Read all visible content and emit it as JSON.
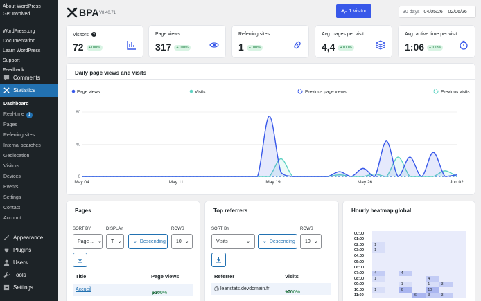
{
  "sidebar": {
    "top_links": [
      "About WordPress",
      "Get Involved",
      "WordPress.org",
      "Documentation",
      "Learn WordPress",
      "Support",
      "Feedback"
    ],
    "comments": "Comments",
    "statistics": "Statistics",
    "subitems": [
      "Dashboard",
      "Real-time",
      "Pages",
      "Referring sites",
      "Internal searches",
      "Geolocation",
      "Visitors",
      "Devices",
      "Events",
      "Settings",
      "Contact",
      "Account"
    ],
    "realtime_badge": "1",
    "bottom": [
      "Appearance",
      "Plugins",
      "Users",
      "Tools",
      "Settings"
    ]
  },
  "header": {
    "logo": "BPA",
    "version": "V8.40.71",
    "visitor_button": "1 Visitor",
    "range_label": "30 days",
    "range_dates": "04/05/26 – 02/06/26"
  },
  "stats": [
    {
      "label": "Visitors",
      "value": "72",
      "change": "+100%",
      "icon": "chart-bars-icon"
    },
    {
      "label": "Page views",
      "value": "317",
      "change": "+100%",
      "icon": "eye-icon"
    },
    {
      "label": "Referring sites",
      "value": "1",
      "change": "+100%",
      "icon": "link-icon"
    },
    {
      "label": "Avg. pages per visit",
      "value": "4,4",
      "change": "+100%",
      "icon": "layers-icon"
    },
    {
      "label": "Avg. active time per visit",
      "value": "1:06",
      "change": "+100%",
      "icon": "timer-icon"
    }
  ],
  "daily": {
    "title": "Daily page views and visits"
  },
  "chart_data": {
    "type": "line",
    "title": "Daily page views and visits",
    "x_ticks": [
      "May 04",
      "May 11",
      "May 19",
      "May 26",
      "Jun 02"
    ],
    "x": [
      "May 04",
      "May 05",
      "May 06",
      "May 07",
      "May 08",
      "May 09",
      "May 10",
      "May 11",
      "May 12",
      "May 13",
      "May 14",
      "May 15",
      "May 16",
      "May 17",
      "May 18",
      "May 19",
      "May 20",
      "May 21",
      "May 22",
      "May 23",
      "May 24",
      "May 25",
      "May 26",
      "May 27",
      "May 28",
      "May 29",
      "May 30",
      "May 31",
      "Jun 01",
      "Jun 02"
    ],
    "ylim": [
      0,
      80
    ],
    "y_ticks": [
      0,
      40,
      80
    ],
    "legend": [
      "Page views",
      "Visits",
      "Previous page views",
      "Previous visits"
    ],
    "series": [
      {
        "name": "Page views",
        "color": "#3858e9",
        "values": [
          0,
          0,
          0,
          0,
          0,
          0,
          0,
          0,
          0,
          0,
          0,
          0,
          0,
          0,
          0,
          0,
          75,
          5,
          0,
          0,
          0,
          0,
          6,
          0,
          10,
          0,
          44,
          0,
          24,
          0,
          30,
          0,
          2
        ]
      },
      {
        "name": "Visits",
        "color": "#5fd3c3",
        "values": [
          0,
          0,
          0,
          0,
          0,
          0,
          0,
          0,
          0,
          0,
          0,
          0,
          0,
          0,
          0,
          0,
          0,
          22,
          0,
          0,
          0,
          0,
          2,
          0,
          0,
          3,
          0,
          24,
          0,
          0,
          0,
          7,
          0
        ]
      },
      {
        "name": "Previous page views",
        "color": "#3858e9",
        "values": [
          0,
          0,
          0,
          0,
          0,
          0,
          0,
          0,
          0,
          0,
          0,
          0,
          0,
          0,
          0,
          0,
          0,
          0,
          0,
          0,
          0,
          0,
          0,
          0,
          0,
          0,
          0,
          0,
          0,
          0,
          0,
          0,
          0
        ]
      },
      {
        "name": "Previous visits",
        "color": "#5fd3c3",
        "values": [
          0,
          0,
          0,
          0,
          0,
          0,
          0,
          0,
          0,
          0,
          0,
          0,
          0,
          0,
          0,
          0,
          0,
          0,
          0,
          0,
          0,
          0,
          0,
          0,
          0,
          0,
          0,
          0,
          0,
          0,
          0,
          0,
          0
        ]
      }
    ]
  },
  "pages": {
    "title": "Pages",
    "sort_by": "SORT BY",
    "display": "DISPLAY",
    "rows": "ROWS",
    "sort_value": "Page ...",
    "display_value": "T.",
    "order_value": "Descending",
    "rows_value": "10",
    "col_title": "Title",
    "col_views": "Page views",
    "row1_title": "Accueil",
    "row1_views": "164",
    "row1_change": "+100%"
  },
  "referrers": {
    "title": "Top referrers",
    "sort_by": "SORT BY",
    "rows": "ROWS",
    "sort_value": "Visits",
    "order_value": "Descending",
    "rows_value": "10",
    "col_ref": "Referrer",
    "col_visits": "Visits",
    "row1_ref": "leanstats.devdomain.fr",
    "row1_visits": "176",
    "row1_change": "+100%"
  },
  "heatmap": {
    "title": "Hourly heatmap global",
    "hours": [
      "00:00",
      "01:00",
      "02:00",
      "03:00",
      "04:00",
      "05:00",
      "06:00",
      "07:00",
      "08:00",
      "09:00",
      "10:00",
      "11:00"
    ],
    "cells": [
      [],
      [],
      [
        {
          "col": 0,
          "v": "1"
        }
      ],
      [
        {
          "col": 0,
          "v": "1"
        }
      ],
      [],
      [],
      [],
      [
        {
          "col": 0,
          "v": "4"
        },
        {
          "col": 2,
          "v": "4"
        }
      ],
      [
        {
          "col": 0,
          "v": "1"
        },
        {
          "col": 4,
          "v": "4"
        }
      ],
      [
        {
          "col": 2,
          "v": "1"
        },
        {
          "col": 4,
          "v": "1"
        },
        {
          "col": 5,
          "v": "3"
        }
      ],
      [
        {
          "col": 0,
          "v": "1"
        },
        {
          "col": 2,
          "v": "6"
        },
        {
          "col": 4,
          "v": "10"
        }
      ],
      [
        {
          "col": 3,
          "v": "6"
        },
        {
          "col": 4,
          "v": "3"
        },
        {
          "col": 5,
          "v": "3"
        }
      ]
    ]
  }
}
